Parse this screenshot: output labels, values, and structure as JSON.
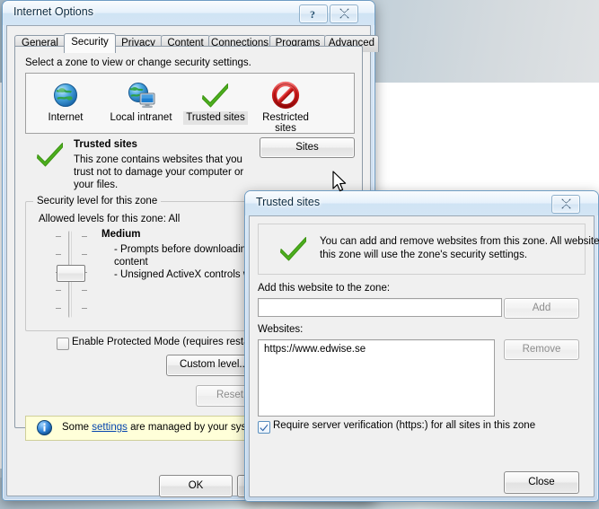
{
  "internet_options": {
    "title": "Internet Options",
    "help_button": "?",
    "close_button": "✕",
    "tabs": [
      {
        "label": "General",
        "active": false
      },
      {
        "label": "Security",
        "active": true
      },
      {
        "label": "Privacy",
        "active": false
      },
      {
        "label": "Content",
        "active": false
      },
      {
        "label": "Connections",
        "active": false
      },
      {
        "label": "Programs",
        "active": false
      },
      {
        "label": "Advanced",
        "active": false
      }
    ],
    "zone_prompt": "Select a zone to view or change security settings.",
    "zones": [
      {
        "label": "Internet",
        "icon": "globe-icon",
        "selected": false
      },
      {
        "label": "Local intranet",
        "icon": "globe-monitor-icon",
        "selected": false
      },
      {
        "label": "Trusted sites",
        "icon": "green-check-icon",
        "selected": true
      },
      {
        "label": "Restricted sites",
        "icon": "red-prohibition-icon",
        "selected": false
      }
    ],
    "zone_detail": {
      "name": "Trusted sites",
      "description_line1": "This zone contains websites that you",
      "description_line2": "trust not to damage your computer or",
      "description_line3": "your files.",
      "icon": "green-check-icon",
      "sites_button": "Sites"
    },
    "security_level": {
      "group_caption": "Security level for this zone",
      "allowed_levels": "Allowed levels for this zone: All",
      "level_name": "Medium",
      "bullet1": "- Prompts before downloading pote",
      "bullet1_cont": "content",
      "bullet2": "- Unsigned ActiveX controls will not",
      "protected_mode_label": "Enable Protected Mode (requires restarting",
      "protected_mode_checked": false,
      "custom_level_button": "Custom level...",
      "reset_button": "Reset all zo",
      "reset_disabled": true
    },
    "info_bar": {
      "text_before": "Some ",
      "link_text": "settings",
      "text_after": " are managed by your system"
    },
    "footer_buttons": [
      {
        "label": "OK",
        "name": "ok-button"
      },
      {
        "label": "",
        "name": "cancel-button"
      }
    ]
  },
  "trusted_sites_dialog": {
    "title": "Trusted sites",
    "close_button": "✕",
    "banner_icon": "green-check-icon",
    "banner_line1": "You can add and remove websites from this zone. All websites in",
    "banner_line2": "this zone will use the zone's security settings.",
    "add_label": "Add this website to the zone:",
    "add_input_value": "",
    "add_button": "Add",
    "add_button_disabled": true,
    "websites_label": "Websites:",
    "websites": [
      "https://www.edwise.se"
    ],
    "remove_button": "Remove",
    "remove_button_disabled": true,
    "require_https_label": "Require server verification (https:) for all sites in this zone",
    "require_https_checked": true,
    "close_action_button": "Close"
  },
  "colors": {
    "accent_green": "#4caf1e",
    "accent_red": "#d31f1f",
    "link": "#0645ad",
    "info_bg": "#ffffd9",
    "dialog_bg": "#f0f0f0"
  }
}
